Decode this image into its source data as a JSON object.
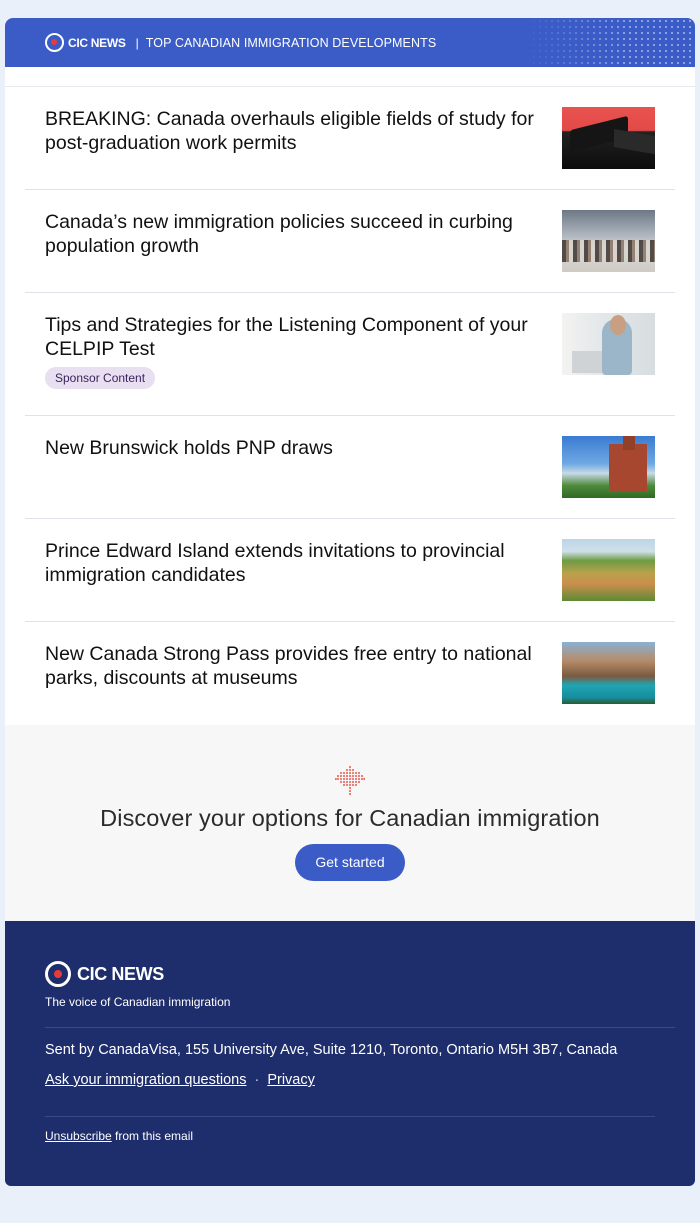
{
  "header": {
    "logo_text": "CIC NEWS",
    "separator": "|",
    "tagline": "TOP CANADIAN IMMIGRATION DEVELOPMENTS"
  },
  "articles": [
    {
      "title": "BREAKING: Canada overhauls eligible fields of study for post-graduation work permits",
      "image": "graduation-caps"
    },
    {
      "title": "Canada’s new immigration policies succeed in curbing population growth",
      "image": "city-crowd"
    },
    {
      "title": "Tips and Strategies for the Listening Component of your CELPIP Test",
      "badge": "Sponsor Content",
      "image": "man-at-laptop"
    },
    {
      "title": "New Brunswick holds PNP draws",
      "image": "red-brick-building"
    },
    {
      "title": "Prince Edward Island extends invitations to provincial immigration candidates",
      "image": "farmland-aerial"
    },
    {
      "title": "New Canada Strong Pass provides free entry to national parks, discounts at museums",
      "image": "mountain-lake"
    }
  ],
  "cta": {
    "icon": "maple-leaf-icon",
    "title": "Discover your options for Canadian immigration",
    "button_label": "Get started"
  },
  "footer": {
    "logo_text": "CIC NEWS",
    "tagline": "The voice of Canadian immigration",
    "address": "Sent by CanadaVisa, 155 University Ave, Suite 1210, Toronto, Ontario M5H 3B7, Canada",
    "link_questions": "Ask your immigration questions",
    "link_separator": "·",
    "link_privacy": "Privacy",
    "unsubscribe_link": "Unsubscribe",
    "unsubscribe_suffix": " from this email"
  },
  "colors": {
    "brand_blue": "#3b5cc7",
    "footer_navy": "#1e2d6b",
    "accent_red": "#e63b3b",
    "badge_bg": "#e8dff0"
  }
}
